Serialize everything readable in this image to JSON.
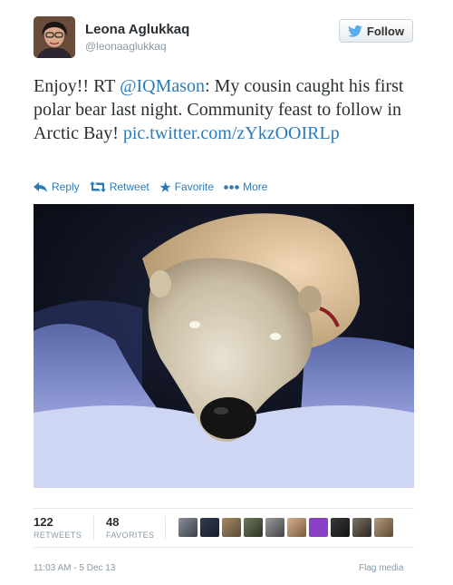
{
  "user": {
    "name": "Leona Aglukkaq",
    "handle": "@leonaaglukkaq",
    "follow_label": "Follow"
  },
  "tweet": {
    "pre": "Enjoy!!  RT ",
    "mention": "@IQMason",
    "body": ": My cousin caught his first polar bear last night. Community feast to follow in Arctic Bay! ",
    "link": "pic.twitter.com/zYkzOOIRLp"
  },
  "actions": {
    "reply": "Reply",
    "retweet": "Retweet",
    "favorite": "Favorite",
    "more": "More"
  },
  "stats": {
    "retweets_count": "122",
    "retweets_label": "RETWEETS",
    "favorites_count": "48",
    "favorites_label": "FAVORITES"
  },
  "footer": {
    "timestamp": "11:03 AM - 5 Dec 13",
    "flag_media": "Flag media"
  },
  "colors": {
    "link": "#2b7bb9",
    "follow_bird": "#55acee"
  }
}
